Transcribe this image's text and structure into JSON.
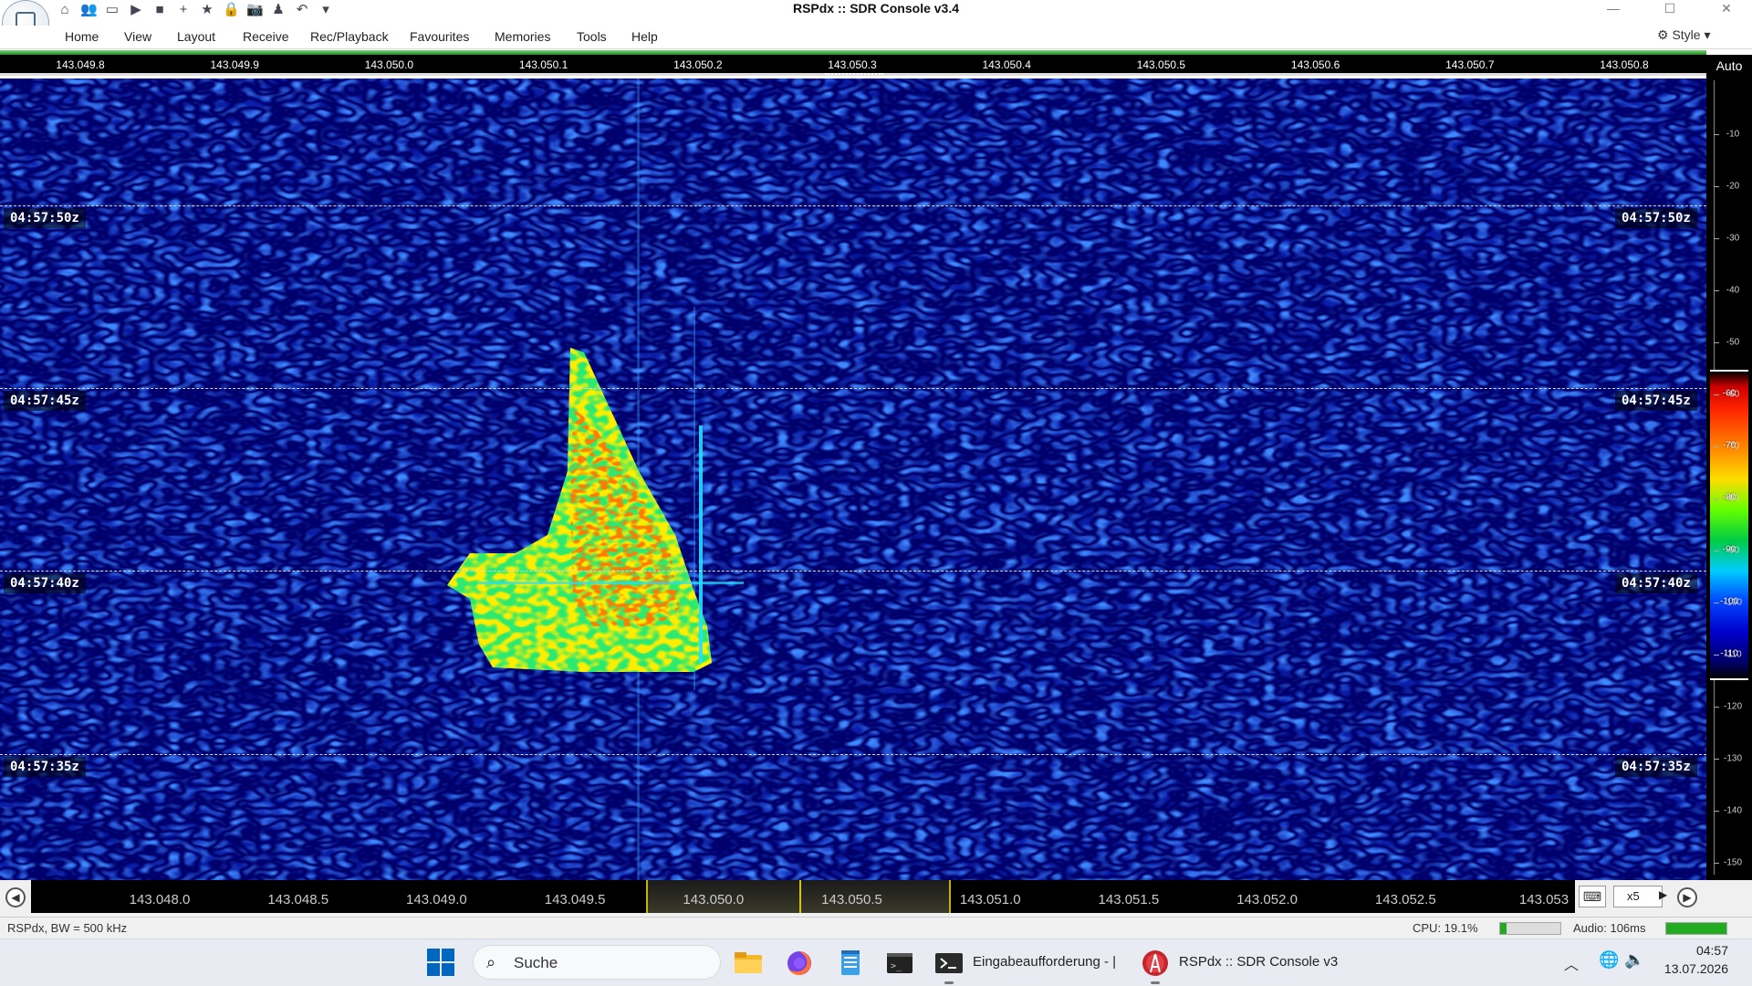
{
  "window": {
    "title": "RSPdx :: SDR Console v3.4",
    "controls": {
      "minimize": "—",
      "maximize": "☐",
      "close": "✕"
    }
  },
  "quick_access": [
    {
      "icon": "home-icon",
      "glyph": "⌂"
    },
    {
      "icon": "users-icon",
      "glyph": "👥"
    },
    {
      "icon": "folder-icon",
      "glyph": "▭"
    },
    {
      "icon": "play-icon",
      "glyph": "▶"
    },
    {
      "icon": "stop-icon",
      "glyph": "■"
    },
    {
      "icon": "add-icon",
      "glyph": "+"
    },
    {
      "icon": "star-icon",
      "glyph": "★"
    },
    {
      "icon": "lock-icon",
      "glyph": "🔒"
    },
    {
      "icon": "camera-icon",
      "glyph": "📷"
    },
    {
      "icon": "person-icon",
      "glyph": "♟"
    },
    {
      "icon": "undo-icon",
      "glyph": "↶"
    },
    {
      "icon": "dropdown-icon",
      "glyph": "▾"
    }
  ],
  "menu": {
    "items": [
      "Home",
      "View",
      "Layout",
      "Receive",
      "Rec/Playback",
      "Favourites",
      "Memories",
      "Tools",
      "Help"
    ],
    "style_label": "Style"
  },
  "top_ruler": {
    "labels": [
      "143.049.8",
      "143.049.9",
      "143.050.0",
      "143.050.1",
      "143.050.2",
      "143.050.3",
      "143.050.4",
      "143.050.5",
      "143.050.6",
      "143.050.7",
      "143.050.8"
    ]
  },
  "waterfall": {
    "time_markers": [
      "04:57:50z",
      "04:57:45z",
      "04:57:40z",
      "04:57:35z"
    ],
    "colors": {
      "background": "#0a1a9a",
      "noise_light": "#2a6aff",
      "noise_dark": "#000033",
      "signal_green": "#33ff55",
      "signal_yellow": "#ffee00",
      "signal_red": "#ff3300",
      "signal_cyan": "#22e0ff"
    }
  },
  "scale": {
    "mode": "Auto",
    "labels": [
      "-10",
      "-20",
      "-30",
      "-40",
      "-50",
      "-60",
      "-70",
      "-80",
      "-90",
      "-100",
      "-110",
      "-120",
      "-130",
      "-140",
      "-150"
    ],
    "colorbar_labels": [
      "-60",
      "-70",
      "-80",
      "-90",
      "-100",
      "-110"
    ]
  },
  "bottom_ruler": {
    "labels": [
      "143.048.0",
      "143.048.5",
      "143.049.0",
      "143.049.5",
      "143.050.0",
      "143.050.5",
      "143.051.0",
      "143.051.5",
      "143.052.0",
      "143.052.5",
      "143.053"
    ],
    "zoom": "x5"
  },
  "status": {
    "left": "RSPdx, BW = 500 kHz",
    "cpu": "CPU: 19.1%",
    "cpu_level": 0.1,
    "audio": "Audio: 106ms",
    "audio_level": 1.0
  },
  "taskbar": {
    "search_placeholder": "Suche",
    "apps": [
      {
        "icon": "file-explorer-icon"
      },
      {
        "icon": "firefox-icon"
      },
      {
        "icon": "notepad-icon"
      },
      {
        "icon": "terminal-icon"
      },
      {
        "icon": "command-prompt-icon",
        "label": "Eingabeaufforderung - |"
      },
      {
        "icon": "sdr-console-icon",
        "label": "RSPdx :: SDR Console v3"
      }
    ],
    "clock_time": "04:57",
    "clock_date": "13.07.2026"
  }
}
